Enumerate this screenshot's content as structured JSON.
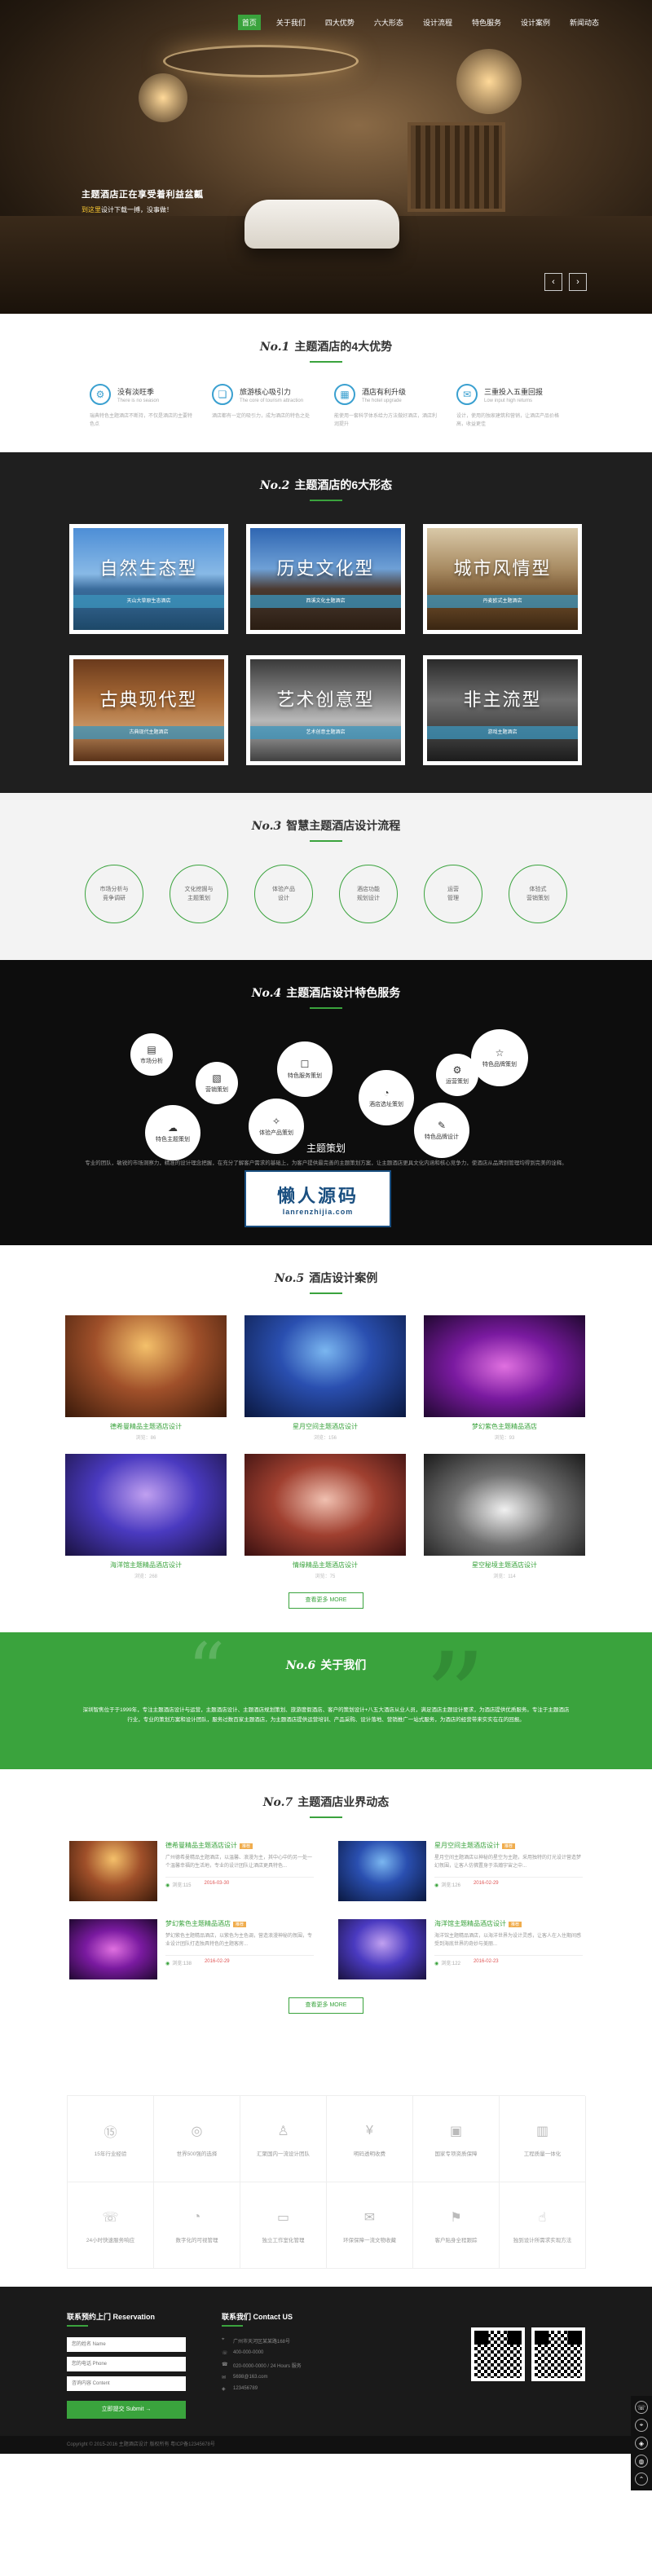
{
  "nav": {
    "items": [
      "首页",
      "关于我们",
      "四大优势",
      "六大形态",
      "设计流程",
      "特色服务",
      "设计案例",
      "新闻动态"
    ]
  },
  "hero": {
    "headline": "主题酒店正在享受着利益盆瓤",
    "sub_prefix": "",
    "sub_highlight": "到这里",
    "sub_rest": "设计下载一搏，没事做！"
  },
  "sections": {
    "s1": {
      "no": "No.1",
      "title": "主题酒店的4大优势"
    },
    "s2": {
      "no": "No.2",
      "title": "主题酒店的6大形态"
    },
    "s3": {
      "no": "No.3",
      "title": "智慧主题酒店设计流程"
    },
    "s4": {
      "no": "No.4",
      "title": "主题酒店设计特色服务"
    },
    "s5": {
      "no": "No.5",
      "title": "酒店设计案例"
    },
    "s6": {
      "no": "No.6",
      "title": "关于我们"
    },
    "s7": {
      "no": "No.7",
      "title": "主题酒店业界动态"
    }
  },
  "advantages": [
    {
      "title": "没有淡旺季",
      "sub": "There is no season",
      "desc": "瑞典特色主题酒店不断持，不仅是酒店的主要特色点"
    },
    {
      "title": "旅游核心吸引力",
      "sub": "The core of tourism attraction",
      "desc": "酒店都有一定的吸引力，成为酒店的特色之处"
    },
    {
      "title": "酒店有利升级",
      "sub": "The hotel upgrade",
      "desc": "能使用一套科学体系给力方法做好酒店，酒店利润提升"
    },
    {
      "title": "三重投入五重回报",
      "sub": "Low input high returns",
      "desc": "设计，使用的独家建筑和营销，让酒店产品价格高，收益更佳"
    }
  ],
  "forms": [
    {
      "label": "自然生态型",
      "band": "天山大草原生态酒店"
    },
    {
      "label": "历史文化型",
      "band": "西溪文化主题酒店"
    },
    {
      "label": "城市风情型",
      "band": "丹麦欧式主题酒店"
    },
    {
      "label": "古典现代型",
      "band": "古典现代主题酒店"
    },
    {
      "label": "艺术创意型",
      "band": "艺术创意主题酒店"
    },
    {
      "label": "非主流型",
      "band": "游戏主题酒店"
    }
  ],
  "flow": [
    {
      "l1": "市场分析与",
      "l2": "竞争调研"
    },
    {
      "l1": "文化挖掘与",
      "l2": "主题策划"
    },
    {
      "l1": "体验产品",
      "l2": "设计"
    },
    {
      "l1": "酒店功能",
      "l2": "规划设计"
    },
    {
      "l1": "运营",
      "l2": "管理"
    },
    {
      "l1": "体验式",
      "l2": "营销策划"
    }
  ],
  "services": [
    {
      "label": "市场分析",
      "icon": "chart-icon"
    },
    {
      "label": "营销策划",
      "icon": "doc-icon"
    },
    {
      "label": "特色服务策划",
      "icon": "chat-icon"
    },
    {
      "label": "酒店选址策划",
      "icon": "gauge-icon"
    },
    {
      "label": "运营策划",
      "icon": "gear-icon"
    },
    {
      "label": "特色品牌策划",
      "icon": "star-icon"
    },
    {
      "label": "特色主题策划",
      "icon": "cloud-icon"
    },
    {
      "label": "体验产品策划",
      "icon": "bulb-icon"
    },
    {
      "label": "特色品牌设计",
      "icon": "pen-icon"
    }
  ],
  "plan": {
    "title": "主题策划",
    "desc": "专业的团队，敏锐的市场洞察力，精准的设计理念把握，在充分了解客户需求的基础上，为客户提供最完善的主题策划方案，让主题酒店更具文化内涵和核心竞争力，使酒店从品牌到管理均得到完美的诠释。"
  },
  "watermark": {
    "cn": "懒人源码",
    "en": "lanrenzhijia.com"
  },
  "cases": [
    {
      "name": "德希曼精品主题酒店设计",
      "views": "浏览：86"
    },
    {
      "name": "星月空间主题酒店设计",
      "views": "浏览：156"
    },
    {
      "name": "梦幻紫色主题精品酒店",
      "views": "浏览：93"
    },
    {
      "name": "海洋馆主题精品酒店设计",
      "views": "浏览：268"
    },
    {
      "name": "情缘精品主题酒店设计",
      "views": "浏览：75"
    },
    {
      "name": "星空秘境主题酒店设计",
      "views": "浏览：114"
    }
  ],
  "more_label": "查看更多 MORE",
  "about": "深圳智焦位于于1999年，专注主题酒店设计与运营，主题酒店设计、主题酒店规划策划、旅游度假酒店、客户的策划设计+八五大酒店从业人员，满足酒店主题设计要求，为酒店提供优质服务。专注于主题酒店行业，专业的策划方案和设计团队，服务过数百家主题酒店，为主题酒店提供运营培训、产品采购、设计落地、营销推广一站式服务，为酒店的经营带来实实在在的回报。",
  "news": [
    {
      "title": "德希曼精品主题酒店设计",
      "tag": "推荐",
      "text": "广州德希曼精品主题酒店，以温馨、浪漫为主，其中心中的另一处一个温馨幸福的生活地，专业的设计团队让酒店更具特色...",
      "views": "浏览:115",
      "date": "2016-03-30"
    },
    {
      "title": "星月空间主题酒店设计",
      "tag": "推荐",
      "text": "星月空间主题酒店以神秘的星空为主题，采用独特的灯光设计营造梦幻氛围，让客人仿佛置身于浩瀚宇宙之中...",
      "views": "浏览:126",
      "date": "2016-02-29"
    },
    {
      "title": "梦幻紫色主题精品酒店",
      "tag": "推荐",
      "text": "梦幻紫色主题精品酒店，以紫色为主色调，营造浪漫神秘的氛围，专业设计团队打造独具特色的主题客房...",
      "views": "浏览:138",
      "date": "2016-02-29"
    },
    {
      "title": "海洋馆主题精品酒店设计",
      "tag": "推荐",
      "text": "海洋馆主题精品酒店，以海洋世界为设计灵感，让客人在入住期间感受到海底世界的奇妙与美丽...",
      "views": "浏览:122",
      "date": "2016-02-23"
    }
  ],
  "more_label2": "查看更多 MORE",
  "service_grid": [
    {
      "label": "15年行业经验",
      "icon": "medal-icon"
    },
    {
      "label": "世界500强的选择",
      "icon": "globe-icon"
    },
    {
      "label": "汇聚国内一流设计团队",
      "icon": "user-icon"
    },
    {
      "label": "明码透明收费",
      "icon": "money-icon"
    },
    {
      "label": "国家专项资质保障",
      "icon": "lock-icon"
    },
    {
      "label": "工程质量一体化",
      "icon": "building-icon"
    },
    {
      "label": "24小时快速服务响应",
      "icon": "phone-icon"
    },
    {
      "label": "数字化的可视管理",
      "icon": "gauge-icon"
    },
    {
      "label": "独立工作室化管理",
      "icon": "board-icon"
    },
    {
      "label": "环保保障一流文物收藏",
      "icon": "mail-icon"
    },
    {
      "label": "客户贴身全程跟踪",
      "icon": "flag-icon"
    },
    {
      "label": "独到设计所需求实现方法",
      "icon": "thumb-icon"
    }
  ],
  "footer": {
    "reservation": "联系预约上门 Reservation",
    "contact_title": "联系我们 Contact US",
    "name_placeholder": "您的姓名 Name",
    "phone_placeholder": "您的电话 Phone",
    "content_placeholder": "咨询内容 Content",
    "submit": "立即提交 Submit →",
    "contacts": [
      {
        "icon": "pin-icon",
        "text": "广州市天河区某某路168号"
      },
      {
        "icon": "phone-icon",
        "text": "400-000-0000"
      },
      {
        "icon": "tel-icon",
        "text": "020-0000-0000 / 24 Hours 服务"
      },
      {
        "icon": "mail-icon",
        "text": "5698@163.com"
      },
      {
        "icon": "qq-icon",
        "text": "123456789"
      }
    ],
    "copyright": "Copyright © 2015-2016 主题酒店设计 版权所有  粤ICP备12345678号"
  },
  "colors": {
    "accent": "#3aa33d",
    "dark": "#1f1f1f",
    "black": "#0d0d0d",
    "blue": "#3aa0d0"
  }
}
